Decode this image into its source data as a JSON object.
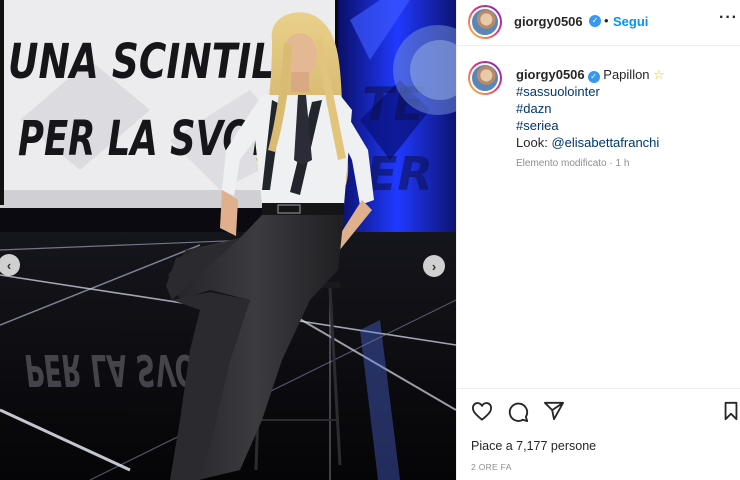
{
  "post": {
    "image": {
      "wall_text_lines": [
        "UNA SCINTILLA",
        "PER LA SVOLTA"
      ],
      "reflection_text": "PER LA SVOLTA",
      "prev_arrow": "‹",
      "next_arrow": "›"
    },
    "header": {
      "username": "giorgy0506",
      "verified_icon": "✓",
      "separator": "•",
      "follow_label": "Segui",
      "more_icon": "···"
    },
    "caption": {
      "username": "giorgy0506",
      "text": "Papillon",
      "emoji": "☆",
      "hashtags": [
        "#sassuolointer",
        "#dazn",
        "#seriea"
      ],
      "look_label": "Look:",
      "mention": "@elisabettafranchi",
      "edited_label": "Elemento modificato · 1 h"
    },
    "actions": {
      "likes_label": "Piace a 7,177 persone",
      "timestamp": "2 ORE FA"
    }
  },
  "colors": {
    "accent": "#0095f6",
    "verified": "#3897f0",
    "link": "#00376b",
    "muted": "#8e8e8e",
    "studio_blue": "#1c3cff"
  }
}
